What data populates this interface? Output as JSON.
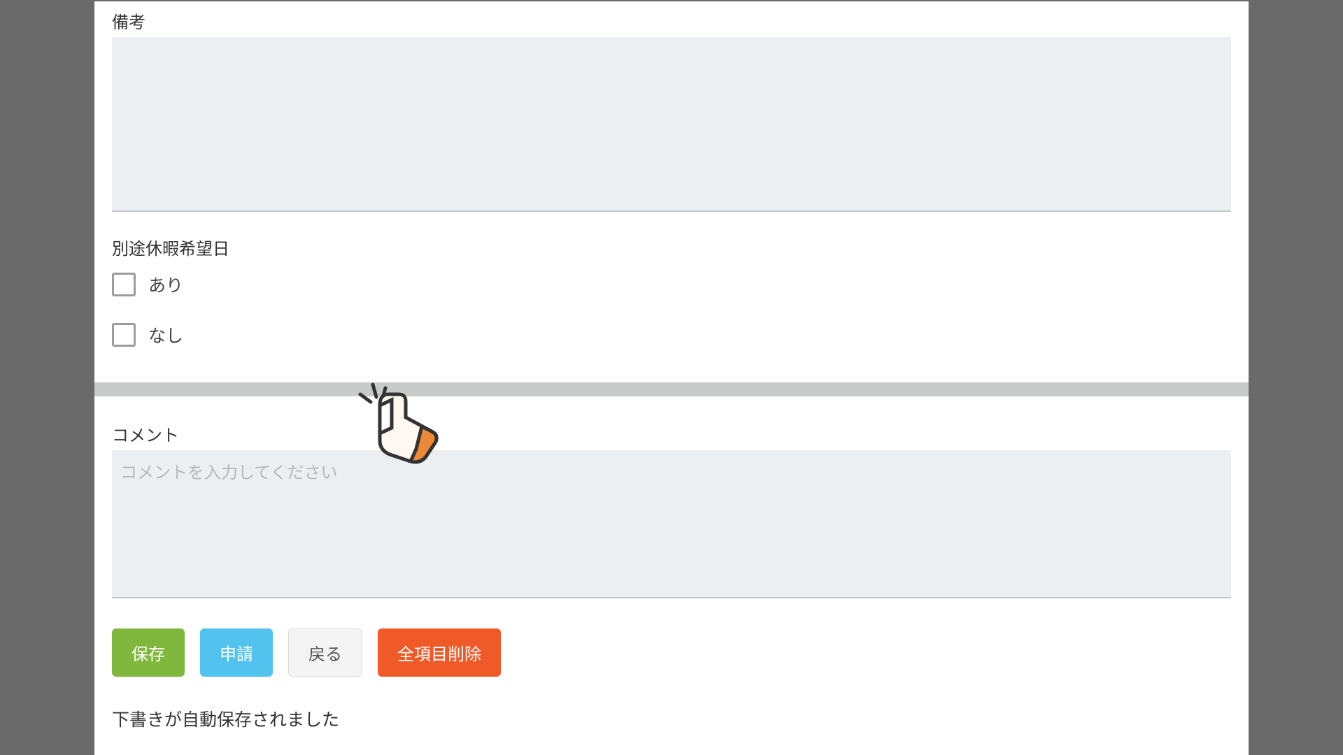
{
  "remarks": {
    "label": "備考",
    "value": ""
  },
  "vacation_request": {
    "label": "別途休暇希望日",
    "options": [
      {
        "label": "あり",
        "checked": false
      },
      {
        "label": "なし",
        "checked": false
      }
    ]
  },
  "comment": {
    "label": "コメント",
    "placeholder": "コメントを入力してください",
    "value": ""
  },
  "buttons": {
    "save": "保存",
    "apply": "申請",
    "back": "戻る",
    "delete_all": "全項目削除"
  },
  "status": "下書きが自動保存されました"
}
